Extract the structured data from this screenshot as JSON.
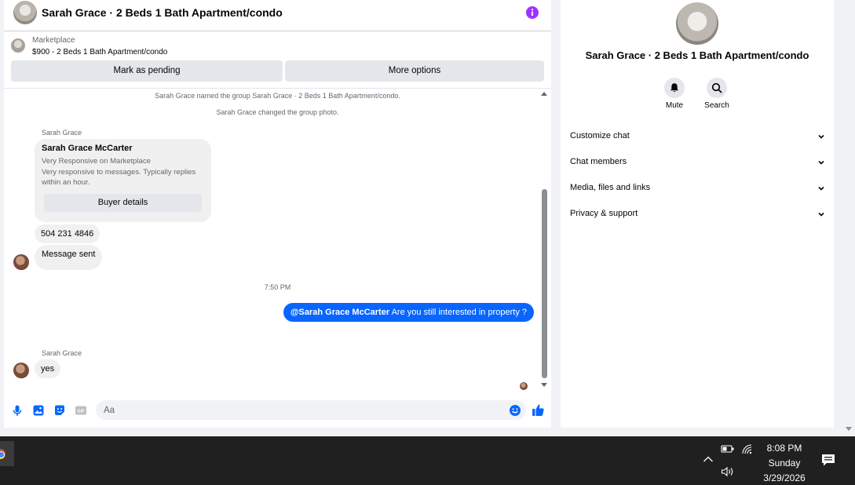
{
  "chat": {
    "title": "Sarah Grace · 2 Beds 1 Bath Apartment/condo",
    "marketplace_label": "Marketplace",
    "listing": "$900 - 2 Beds 1 Bath Apartment/condo",
    "mark_pending_label": "Mark as pending",
    "more_options_label": "More options",
    "system_notes": [
      "Sarah Grace named the group Sarah Grace · 2 Beds 1 Bath Apartment/condo.",
      "Sarah Grace changed the group photo."
    ],
    "sender_name": "Sarah Grace",
    "card": {
      "name": "Sarah Grace McCarter",
      "line1": "Very Responsive on Marketplace",
      "line2": "Very responsive to messages. Typically replies",
      "line3": "within an hour.",
      "button": "Buyer details"
    },
    "phone_message": "504 231 4846",
    "sent_message": "Message sent",
    "timestamp": "7:50 PM",
    "own_message": {
      "mention": "@Sarah Grace McCarter",
      "text": " Are you still interested in property ?"
    },
    "reply_sender": "Sarah Grace",
    "reply": "yes",
    "composer": {
      "placeholder": "Aa",
      "icons": [
        "microphone-icon",
        "image-icon",
        "sticker-icon",
        "gif-icon",
        "emoji-icon",
        "thumbs-up-icon"
      ],
      "gif_label": "GIF"
    },
    "accent_color": "#0866ff",
    "info_icon_color": "#a033ff"
  },
  "info_panel": {
    "title": "Sarah Grace · 2 Beds 1 Bath Apartment/condo",
    "mute_label": "Mute",
    "search_label": "Search",
    "rows": [
      {
        "label": "Customize chat"
      },
      {
        "label": "Chat members"
      },
      {
        "label": "Media, files and links"
      },
      {
        "label": "Privacy & support"
      }
    ]
  },
  "taskbar": {
    "time": "8:08 PM",
    "day": "Sunday",
    "date": "3/29/2026",
    "tray_icons": [
      "chevron-up-icon",
      "battery-icon",
      "wifi-icon",
      "volume-icon",
      "notification-icon"
    ]
  }
}
